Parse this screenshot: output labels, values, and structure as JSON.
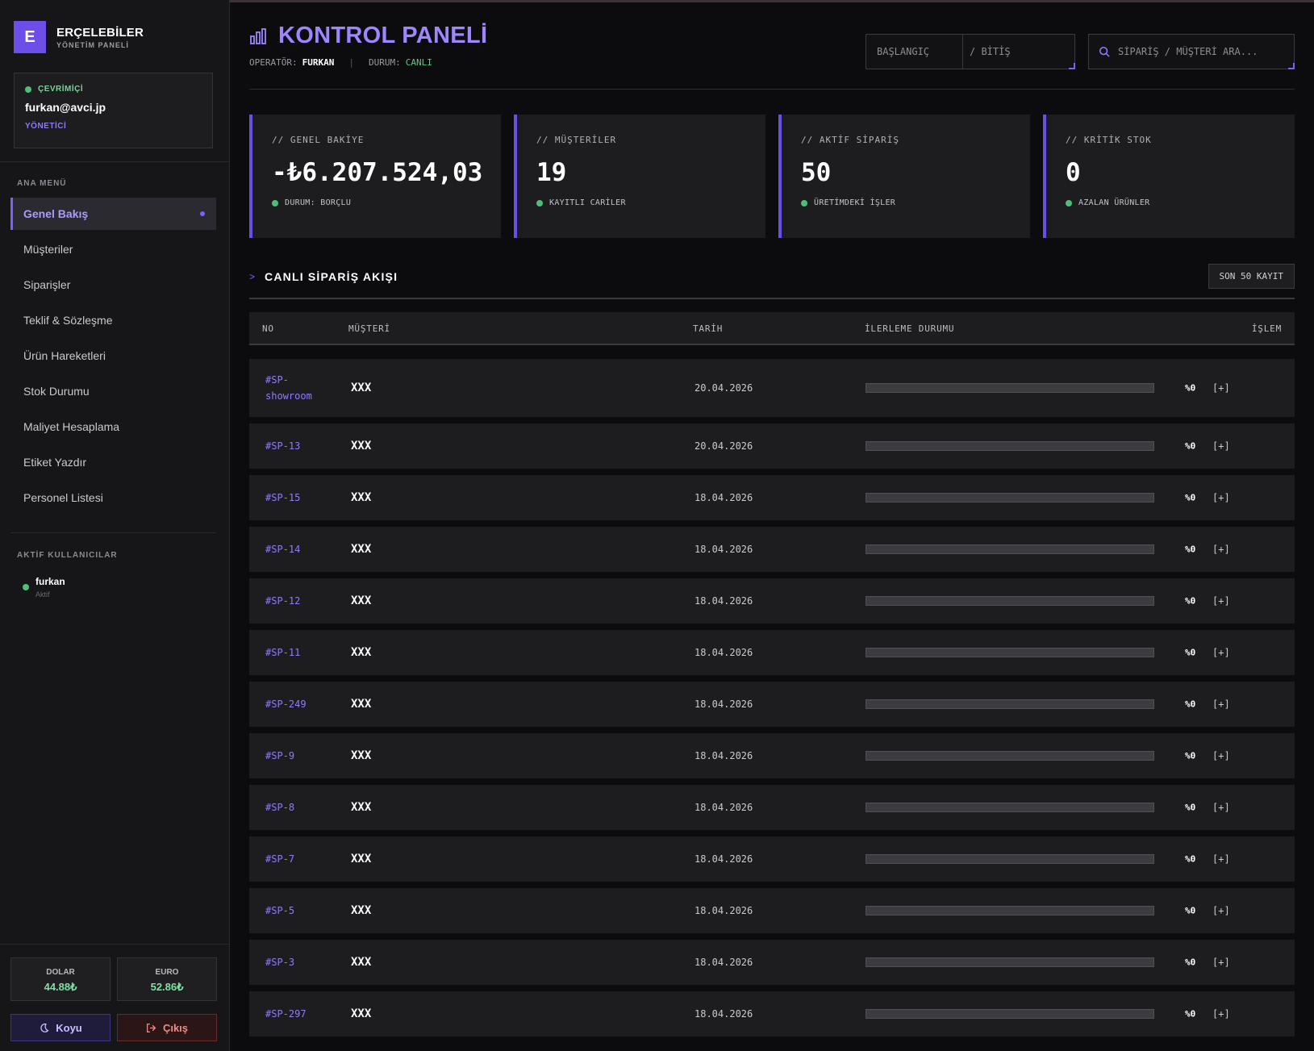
{
  "brand": {
    "logo_letter": "E",
    "title": "ERÇELEBİLER",
    "subtitle": "YÖNETİM PANELİ"
  },
  "user": {
    "status": "ÇEVRİMİÇİ",
    "email": "furkan@avci.jp",
    "role": "YÖNETİCİ"
  },
  "menu": {
    "title": "ANA MENÜ",
    "items": [
      {
        "label": "Genel Bakış",
        "active": true
      },
      {
        "label": "Müşteriler"
      },
      {
        "label": "Siparişler"
      },
      {
        "label": "Teklif & Sözleşme"
      },
      {
        "label": "Ürün Hareketleri"
      },
      {
        "label": "Stok Durumu"
      },
      {
        "label": "Maliyet Hesaplama"
      },
      {
        "label": "Etiket Yazdır"
      },
      {
        "label": "Personel Listesi"
      }
    ]
  },
  "active_users": {
    "title": "AKTİF KULLANICILAR",
    "name": "furkan",
    "status": "Aktif"
  },
  "fx": {
    "dollar": {
      "label": "DOLAR",
      "value": "44.88₺"
    },
    "euro": {
      "label": "EURO",
      "value": "52.86₺"
    }
  },
  "buttons": {
    "theme": "Koyu",
    "logout": "Çıkış"
  },
  "header": {
    "title": "KONTROL PANELİ",
    "operator_label": "OPERATÖR:",
    "operator": "FURKAN",
    "status_label": "DURUM:",
    "status": "CANLI",
    "date_start": "BAŞLANGIÇ",
    "date_end": "/  BİTİŞ",
    "search_placeholder": "SİPARİŞ / MÜŞTERİ ARA..."
  },
  "cards": [
    {
      "label": "// GENEL BAKİYE",
      "value": "-₺6.207.524,03",
      "foot": "DURUM: BORÇLU"
    },
    {
      "label": "// MÜŞTERİLER",
      "value": "19",
      "foot": "KAYITLI CARİLER"
    },
    {
      "label": "// AKTİF SİPARİŞ",
      "value": "50",
      "foot": "ÜRETİMDEKİ İŞLER"
    },
    {
      "label": "// KRİTİK STOK",
      "value": "0",
      "foot": "AZALAN ÜRÜNLER"
    }
  ],
  "orders": {
    "title": "CANLI SİPARİŞ AKIŞI",
    "badge": "SON 50 KAYIT",
    "columns": {
      "no": "NO",
      "customer": "MÜŞTERİ",
      "date": "TARİH",
      "progress": "İLERLEME DURUMU",
      "action": "İŞLEM"
    },
    "rows": [
      {
        "no": "#SP-showroom",
        "customer": "XXX",
        "date": "20.04.2026",
        "progress": 0,
        "pct": "%0",
        "action": "[+]"
      },
      {
        "no": "#SP-13",
        "customer": "XXX",
        "date": "20.04.2026",
        "progress": 0,
        "pct": "%0",
        "action": "[+]"
      },
      {
        "no": "#SP-15",
        "customer": "XXX",
        "date": "18.04.2026",
        "progress": 0,
        "pct": "%0",
        "action": "[+]"
      },
      {
        "no": "#SP-14",
        "customer": "XXX",
        "date": "18.04.2026",
        "progress": 0,
        "pct": "%0",
        "action": "[+]"
      },
      {
        "no": "#SP-12",
        "customer": "XXX",
        "date": "18.04.2026",
        "progress": 0,
        "pct": "%0",
        "action": "[+]"
      },
      {
        "no": "#SP-11",
        "customer": "XXX",
        "date": "18.04.2026",
        "progress": 0,
        "pct": "%0",
        "action": "[+]"
      },
      {
        "no": "#SP-249",
        "customer": "XXX",
        "date": "18.04.2026",
        "progress": 0,
        "pct": "%0",
        "action": "[+]"
      },
      {
        "no": "#SP-9",
        "customer": "XXX",
        "date": "18.04.2026",
        "progress": 0,
        "pct": "%0",
        "action": "[+]"
      },
      {
        "no": "#SP-8",
        "customer": "XXX",
        "date": "18.04.2026",
        "progress": 0,
        "pct": "%0",
        "action": "[+]"
      },
      {
        "no": "#SP-7",
        "customer": "XXX",
        "date": "18.04.2026",
        "progress": 0,
        "pct": "%0",
        "action": "[+]"
      },
      {
        "no": "#SP-5",
        "customer": "XXX",
        "date": "18.04.2026",
        "progress": 0,
        "pct": "%0",
        "action": "[+]"
      },
      {
        "no": "#SP-3",
        "customer": "XXX",
        "date": "18.04.2026",
        "progress": 0,
        "pct": "%0",
        "action": "[+]"
      },
      {
        "no": "#SP-297",
        "customer": "XXX",
        "date": "18.04.2026",
        "progress": 0,
        "pct": "%0",
        "action": "[+]"
      }
    ]
  },
  "colors": {
    "accent": "#7b61ff",
    "online": "#4fbf78",
    "positive": "#7ee0a3",
    "danger": "#f08a8a"
  },
  "icons": {
    "title_icon": "bar-chart-icon",
    "search_icon": "search-icon",
    "theme_icon": "moon-icon",
    "logout_icon": "logout-icon"
  }
}
